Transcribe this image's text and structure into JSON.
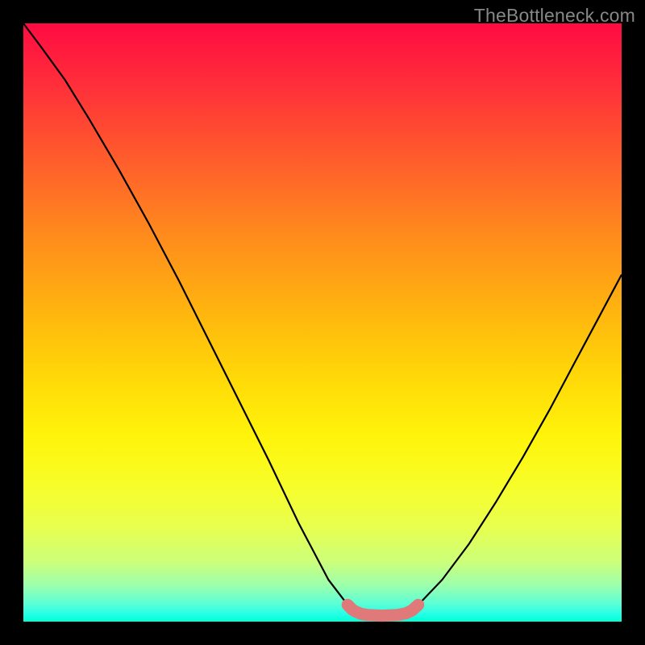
{
  "watermark": "TheBottleneck.com",
  "chart_data": {
    "type": "line",
    "title": "",
    "xlabel": "",
    "ylabel": "",
    "xlim": [
      0,
      1
    ],
    "ylim": [
      0,
      1
    ],
    "series": [
      {
        "name": "left-branch",
        "x": [
          0.0,
          0.03,
          0.07,
          0.11,
          0.16,
          0.21,
          0.26,
          0.31,
          0.36,
          0.41,
          0.46,
          0.51,
          0.542
        ],
        "y": [
          1.0,
          0.96,
          0.905,
          0.84,
          0.755,
          0.665,
          0.57,
          0.47,
          0.37,
          0.27,
          0.165,
          0.07,
          0.028
        ]
      },
      {
        "name": "right-branch",
        "x": [
          0.66,
          0.7,
          0.745,
          0.79,
          0.835,
          0.88,
          0.92,
          0.96,
          1.0
        ],
        "y": [
          0.028,
          0.07,
          0.13,
          0.2,
          0.275,
          0.355,
          0.43,
          0.505,
          0.58
        ]
      },
      {
        "name": "valley-floor-marker",
        "x": [
          0.542,
          0.55,
          0.555,
          0.565,
          0.575,
          0.6,
          0.625,
          0.64,
          0.65,
          0.66
        ],
        "y": [
          0.028,
          0.02,
          0.017,
          0.013,
          0.011,
          0.01,
          0.011,
          0.014,
          0.019,
          0.028
        ]
      }
    ],
    "colors": {
      "curve": "#000000",
      "floor_marker": "#e07a7a"
    }
  }
}
